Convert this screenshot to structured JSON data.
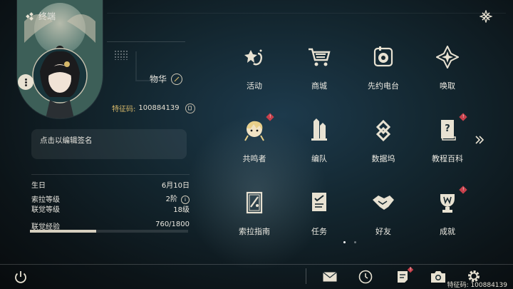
{
  "header": {
    "title": "终端"
  },
  "profile": {
    "name": "物华",
    "id_label": "特征码:",
    "id_value": "100884139",
    "signature_placeholder": "点击以编辑签名"
  },
  "stats": [
    {
      "label": "生日",
      "value": "6月10日"
    },
    {
      "label": "索拉等级",
      "value": "2阶"
    },
    {
      "label": "联觉等级",
      "value": "18级"
    }
  ],
  "experience": {
    "label": "联觉经验",
    "value": "760/1800",
    "progress": 0.42
  },
  "menu": [
    {
      "label": "活动",
      "icon": "event-icon",
      "badge": false
    },
    {
      "label": "商城",
      "icon": "shop-cart-icon",
      "badge": false
    },
    {
      "label": "先约电台",
      "icon": "radio-icon",
      "badge": false
    },
    {
      "label": "唤取",
      "icon": "convene-icon",
      "badge": false
    },
    {
      "label": "共鸣者",
      "icon": "resonator-icon",
      "badge": true
    },
    {
      "label": "编队",
      "icon": "team-icon",
      "badge": false
    },
    {
      "label": "数据坞",
      "icon": "data-bank-icon",
      "badge": false
    },
    {
      "label": "教程百科",
      "icon": "tutorial-icon",
      "badge": true
    },
    {
      "label": "索拉指南",
      "icon": "guidebook-icon",
      "badge": false
    },
    {
      "label": "任务",
      "icon": "quest-icon",
      "badge": false
    },
    {
      "label": "好友",
      "icon": "friends-icon",
      "badge": false
    },
    {
      "label": "成就",
      "icon": "achievement-icon",
      "badge": true
    }
  ],
  "bottom_bar": {
    "icons": [
      "mail-icon",
      "clock-icon",
      "notice-icon",
      "camera-icon",
      "settings-icon"
    ],
    "id_text": "特征码: 100884139"
  },
  "badge_mark": "!",
  "colors": {
    "accent_gold": "#d6b86a",
    "badge_red": "#c7404b",
    "text": "#e8e6df"
  }
}
